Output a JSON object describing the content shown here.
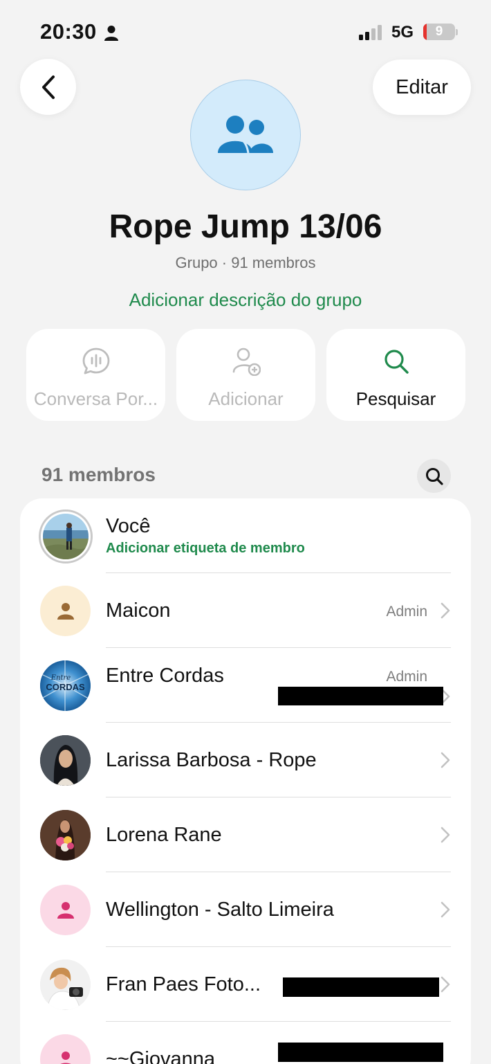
{
  "status_bar": {
    "time": "20:30",
    "network": "5G",
    "battery": "9",
    "battery_level": 0.09
  },
  "nav": {
    "edit_label": "Editar"
  },
  "group": {
    "title": "Rope Jump 13/06",
    "subtitle": "Grupo · 91 membros",
    "description_link": "Adicionar descrição do grupo"
  },
  "actions": [
    {
      "label": "Conversa Por...",
      "icon": "voice-chat-icon",
      "enabled": false
    },
    {
      "label": "Adicionar",
      "icon": "add-person-icon",
      "enabled": false
    },
    {
      "label": "Pesquisar",
      "icon": "search-icon",
      "enabled": true
    }
  ],
  "members": {
    "count_label": "91 membros",
    "list": [
      {
        "name": "Você",
        "tag": "Adicionar etiqueta de membro",
        "role": "",
        "avatar": "photo-beach"
      },
      {
        "name": "Maicon",
        "role": "Admin",
        "avatar": "default-beige"
      },
      {
        "name": "Entre Cordas",
        "role": "Admin",
        "avatar": "logo-entre-cordas"
      },
      {
        "name": "Larissa Barbosa - Rope",
        "role": "",
        "avatar": "photo-dark"
      },
      {
        "name": "Lorena Rane",
        "role": "",
        "avatar": "photo-flowers"
      },
      {
        "name": "Wellington - Salto Limeira",
        "role": "",
        "avatar": "default-pink"
      },
      {
        "name": "Fran Paes Foto...",
        "role": "",
        "avatar": "photo-camera"
      },
      {
        "name": "~~Giovanna",
        "role": "",
        "avatar": "default-pink"
      }
    ]
  },
  "colors": {
    "accent_green": "#1f8a4c",
    "background": "#f3f3f3",
    "group_avatar": "#d3ebfb",
    "group_icon": "#1d7fc0"
  }
}
